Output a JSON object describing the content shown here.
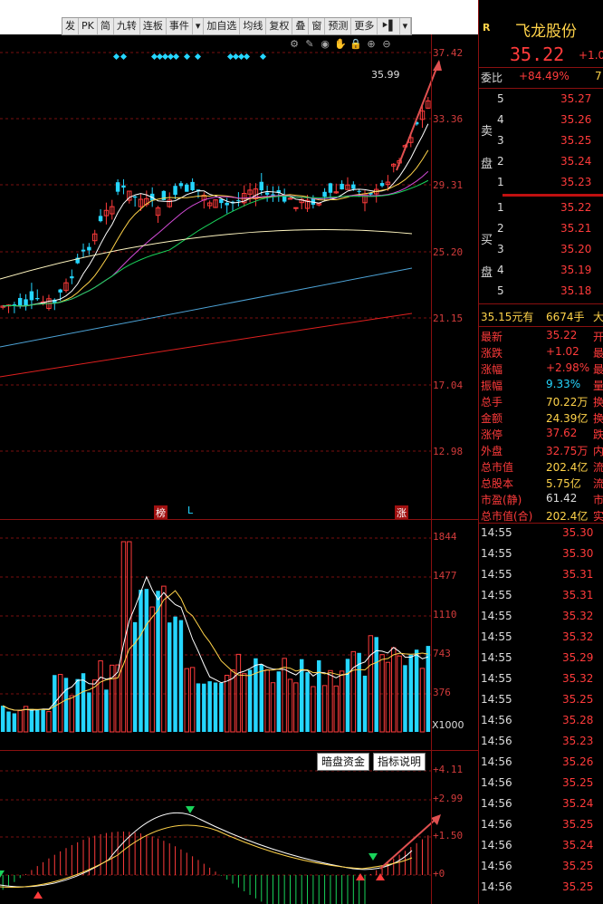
{
  "toolbar": {
    "items": [
      "发",
      "PK",
      "简",
      "九转",
      "连板",
      "事件",
      "▾",
      "加自选",
      "均线",
      "复权",
      "叠",
      "窗",
      "预测",
      "更多",
      "⯈▌",
      "▾"
    ]
  },
  "main_chart": {
    "y_labels": [
      "37.42",
      "33.36",
      "29.31",
      "25.20",
      "21.15",
      "17.04",
      "12.98"
    ],
    "peak_label": "35.99",
    "markers": {
      "bang": "榜",
      "L": "L",
      "zhang": "涨"
    }
  },
  "volume_chart": {
    "y_labels": [
      "1844",
      "1477",
      "1110",
      "743",
      "376"
    ],
    "unit": "X1000"
  },
  "indicator": {
    "buttons": [
      "暗盘资金",
      "指标说明"
    ],
    "y_labels": [
      "+4.11",
      "+2.99",
      "+1.50",
      "+0"
    ]
  },
  "right_panel": {
    "r_badge": "R",
    "stock_name": "飞龙股份",
    "price": "35.22",
    "change": "+1.0",
    "weibi_label": "委比",
    "weibi_value": "+84.49%",
    "weibi_extra": "7",
    "sell_label": "卖盘",
    "buy_label": "买盘",
    "sell": [
      {
        "lvl": "5",
        "price": "35.27"
      },
      {
        "lvl": "4",
        "price": "35.26"
      },
      {
        "lvl": "3",
        "price": "35.25"
      },
      {
        "lvl": "2",
        "price": "35.24"
      },
      {
        "lvl": "1",
        "price": "35.23"
      }
    ],
    "buy": [
      {
        "lvl": "1",
        "price": "35.22"
      },
      {
        "lvl": "2",
        "price": "35.21"
      },
      {
        "lvl": "3",
        "price": "35.20"
      },
      {
        "lvl": "4",
        "price": "35.19"
      },
      {
        "lvl": "5",
        "price": "35.18"
      }
    ],
    "big_order": {
      "price": "35.15元有",
      "vol": "6674手",
      "tail": "大"
    },
    "stats": [
      {
        "k": "最新",
        "v": "35.22",
        "t": "开",
        "c": "red"
      },
      {
        "k": "涨跌",
        "v": "+1.02",
        "t": "最",
        "c": "red"
      },
      {
        "k": "涨幅",
        "v": "+2.98%",
        "t": "最",
        "c": "red"
      },
      {
        "k": "振幅",
        "v": "9.33%",
        "t": "量",
        "c": "cyan"
      },
      {
        "k": "总手",
        "v": "70.22万",
        "t": "换",
        "c": "yellow"
      },
      {
        "k": "金额",
        "v": "24.39亿",
        "t": "换",
        "c": "yellow"
      },
      {
        "k": "涨停",
        "v": "37.62",
        "t": "跌",
        "c": "red"
      },
      {
        "k": "外盘",
        "v": "32.75万",
        "t": "内",
        "c": "red"
      },
      {
        "k": "总市值",
        "v": "202.4亿",
        "t": "流",
        "c": "yellow"
      },
      {
        "k": "总股本",
        "v": "5.75亿",
        "t": "流",
        "c": "yellow"
      },
      {
        "k": "市盈(静)",
        "v": "61.42",
        "t": "市",
        "c": "white"
      },
      {
        "k": "总市值(合)",
        "v": "202.4亿",
        "t": "实",
        "c": "yellow"
      }
    ],
    "ticks": [
      {
        "t": "14:55",
        "p": "35.30"
      },
      {
        "t": "14:55",
        "p": "35.30"
      },
      {
        "t": "14:55",
        "p": "35.31"
      },
      {
        "t": "14:55",
        "p": "35.31"
      },
      {
        "t": "14:55",
        "p": "35.32"
      },
      {
        "t": "14:55",
        "p": "35.32"
      },
      {
        "t": "14:55",
        "p": "35.29"
      },
      {
        "t": "14:55",
        "p": "35.32"
      },
      {
        "t": "14:55",
        "p": "35.25"
      },
      {
        "t": "14:56",
        "p": "35.28"
      },
      {
        "t": "14:56",
        "p": "35.23"
      },
      {
        "t": "14:56",
        "p": "35.26"
      },
      {
        "t": "14:56",
        "p": "35.25"
      },
      {
        "t": "14:56",
        "p": "35.24"
      },
      {
        "t": "14:56",
        "p": "35.25"
      },
      {
        "t": "14:56",
        "p": "35.24"
      },
      {
        "t": "14:56",
        "p": "35.25"
      },
      {
        "t": "14:56",
        "p": "35.25"
      }
    ]
  },
  "colors": {
    "up": "#ff3b3b",
    "down": "#25d6ff",
    "grid": "#7a1010",
    "bg": "#000000"
  }
}
